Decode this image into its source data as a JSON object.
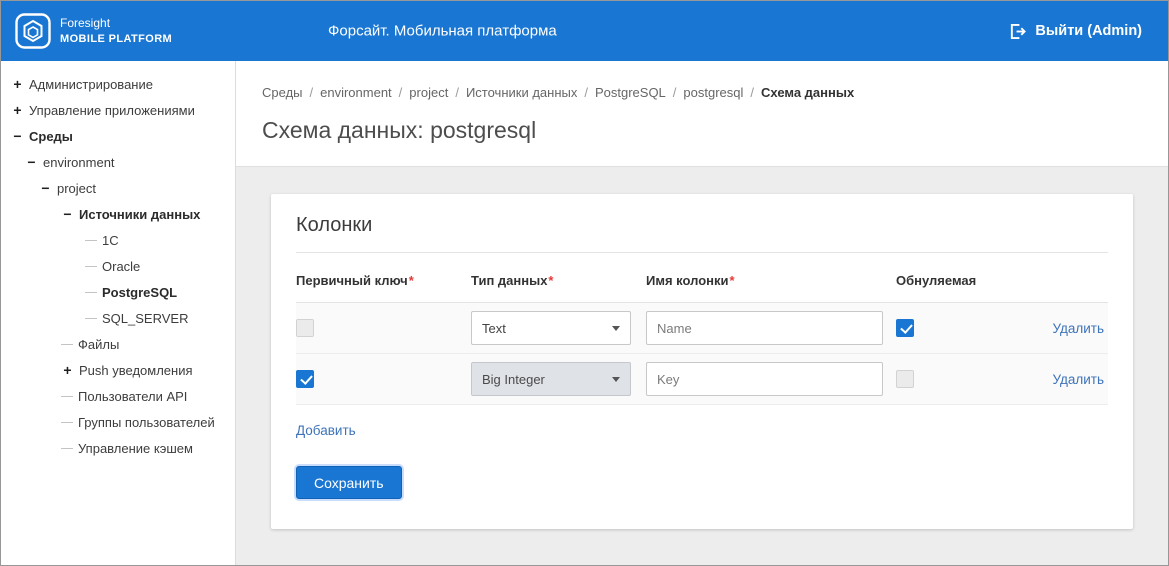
{
  "topbar": {
    "logo_line1": "Foresight",
    "logo_line2": "MOBILE PLATFORM",
    "title": "Форсайт. Мобильная платформа",
    "logout": "Выйти (Admin)"
  },
  "sidebar": {
    "items": [
      {
        "label": "Администрирование",
        "icon": "+"
      },
      {
        "label": "Управление приложениями",
        "icon": "+"
      },
      {
        "label": "Среды",
        "icon": "−"
      },
      {
        "label": "environment",
        "icon": "−"
      },
      {
        "label": "project",
        "icon": "−"
      },
      {
        "label": "Источники данных",
        "icon": "−"
      },
      {
        "label": "1C",
        "icon": ""
      },
      {
        "label": "Oracle",
        "icon": ""
      },
      {
        "label": "PostgreSQL",
        "icon": ""
      },
      {
        "label": "SQL_SERVER",
        "icon": ""
      },
      {
        "label": "Файлы",
        "icon": ""
      },
      {
        "label": "Push уведомления",
        "icon": "+"
      },
      {
        "label": "Пользователи API",
        "icon": ""
      },
      {
        "label": "Группы пользователей",
        "icon": ""
      },
      {
        "label": "Управление кэшем",
        "icon": ""
      }
    ]
  },
  "breadcrumb": {
    "separator": "/",
    "items": [
      "Среды",
      "environment",
      "project",
      "Источники данных",
      "PostgreSQL",
      "postgresql",
      "Схема данных"
    ]
  },
  "page": {
    "title": "Схема данных: postgresql"
  },
  "card": {
    "title": "Колонки",
    "required_mark": "*",
    "headers": [
      "Первичный ключ",
      "Тип данных",
      "Имя колонки",
      "Обнуляемая"
    ],
    "rows": [
      {
        "primary_key": false,
        "data_type": "Text",
        "type_disabled": false,
        "column_name": "Name",
        "nullable": true,
        "delete": "Удалить"
      },
      {
        "primary_key": true,
        "data_type": "Big Integer",
        "type_disabled": true,
        "column_name": "Key",
        "nullable": false,
        "delete": "Удалить"
      }
    ],
    "add": "Добавить",
    "save": "Сохранить"
  },
  "colors": {
    "topbar": "#1976d2",
    "accent": "#1976d2",
    "link": "#3e73b9",
    "required": "#e53935",
    "content_bg": "#ededed"
  }
}
